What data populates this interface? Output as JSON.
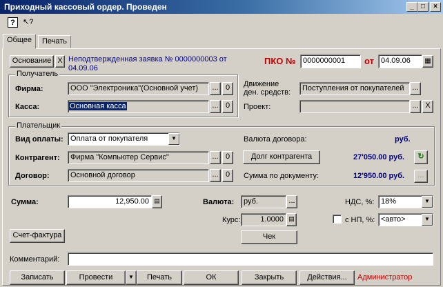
{
  "window": {
    "title": "Приходный кассовый ордер. Проведен"
  },
  "tabs": [
    "Общее",
    "Печать"
  ],
  "header": {
    "base_button": "Основание",
    "x": "X",
    "unconfirmed_link": "Неподтвержденная заявка № 0000000003 от 04.09.06",
    "pko_label": "ПКО №",
    "pko_number": "0000000001",
    "from_label": "от",
    "date": "04.09.06"
  },
  "receiver": {
    "group_title": "Получатель",
    "firm_label": "Фирма:",
    "firm_value": "ООО \"Электроника\"(Основной учет)",
    "cash_label": "Касса:",
    "cash_value": "Основная касса",
    "movement_label_1": "Движение",
    "movement_label_2": "ден. средств:",
    "movement_value": "Поступления от покупателей",
    "project_label": "Проект:",
    "project_value": ""
  },
  "payer": {
    "group_title": "Плательщик",
    "pay_type_label": "Вид оплаты:",
    "pay_type_value": "Оплата от покупателя",
    "contractor_label": "Контрагент:",
    "contractor_value": "Фирма \"Компьютер Сервис\"",
    "contract_label": "Договор:",
    "contract_value": "Основной договор",
    "currency_label": "Валюта договора:",
    "currency_value": "руб.",
    "debt_button": "Долг контрагента",
    "debt_value": "27'050.00 руб.",
    "sum_doc_label": "Сумма по документу:",
    "sum_doc_value": "12'950.00 руб."
  },
  "totals": {
    "sum_label": "Сумма:",
    "sum_value": "12,950.00",
    "currency_label": "Валюта:",
    "currency_value": "руб.",
    "rate_label": "Курс:",
    "rate_value": "1.0000",
    "nds_label": "НДС, %:",
    "nds_value": "18%",
    "np_label": "с НП, %:",
    "np_value": "<авто>",
    "check_button": "Чек",
    "invoice_button": "Счет-фактура"
  },
  "comment": {
    "label": "Комментарий:",
    "value": ""
  },
  "footer": {
    "save": "Записать",
    "post": "Провести",
    "print": "Печать",
    "ok": "ОК",
    "close": "Закрыть",
    "actions": "Действия...",
    "user": "Администратор"
  },
  "zero": "0",
  "dots": "...",
  "colors": {
    "title_start": "#0a246a",
    "navy_text": "#000080",
    "red_text": "#c00000",
    "face": "#d4d0c8"
  },
  "icons": [
    "help-icon",
    "pointer-help-icon",
    "calculator-icon",
    "refresh-icon",
    "calendar-icon",
    "dropdown-arrow-icon"
  ]
}
